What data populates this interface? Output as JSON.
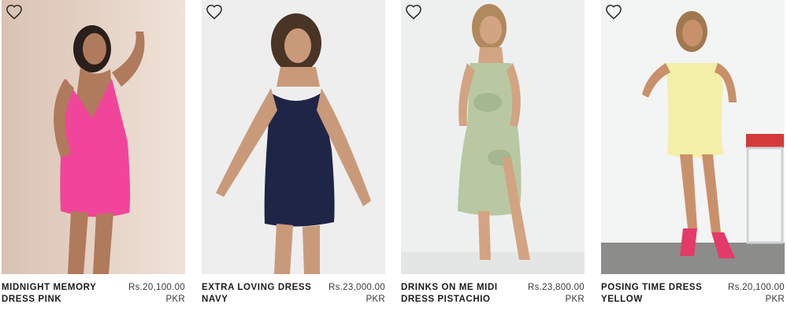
{
  "products": [
    {
      "name": "MIDNIGHT MEMORY DRESS PINK",
      "price": "Rs.20,100.00",
      "currency": "PKR",
      "dress_color": "#f0459a",
      "bg": "#e7d4c6"
    },
    {
      "name": "EXTRA LOVING DRESS NAVY",
      "price": "Rs.23,000.00",
      "currency": "PKR",
      "dress_color": "#1f2547",
      "bg": "#efefef"
    },
    {
      "name": "DRINKS ON ME MIDI DRESS PISTACHIO",
      "price": "Rs.23,800.00",
      "currency": "PKR",
      "dress_color": "#b7c8a2",
      "bg": "#eef0f0"
    },
    {
      "name": "POSING TIME DRESS YELLOW",
      "price": "Rs.20,100.00",
      "currency": "PKR",
      "dress_color": "#f3efa8",
      "bg": "#f3f4f4"
    }
  ],
  "icons": {
    "wishlist": "heart-outline-icon"
  }
}
